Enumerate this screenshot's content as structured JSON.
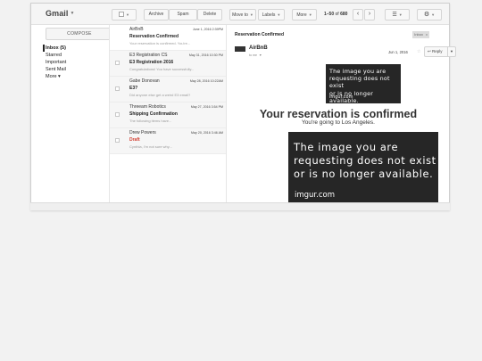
{
  "app": {
    "title": "Gmail"
  },
  "toolbar": {
    "archive_label": "Archive",
    "spam_label": "Spam",
    "delete_label": "Delete",
    "move_to_label": "Move to",
    "labels_label": "Labels",
    "more_label": "More",
    "pager_range": "1–50",
    "pager_of": "of",
    "pager_total": "680",
    "prev_icon": "chevron-left",
    "next_icon": "chevron-right",
    "view_icon": "list-icon",
    "settings_icon": "gear-icon"
  },
  "sidebar": {
    "compose_label": "COMPOSE",
    "items": [
      {
        "label": "Inbox (5)",
        "active": true
      },
      {
        "label": "Starred"
      },
      {
        "label": "Important"
      },
      {
        "label": "Sent Mail"
      },
      {
        "label": "More ▾"
      }
    ]
  },
  "messages": [
    {
      "sender": "AirBnB",
      "date": "June 1, 2016 2:39PM",
      "subject": "Reservation Confirmed",
      "snippet": "Your reservation is confirmed. You're..."
    },
    {
      "sender": "E3 Registration CS",
      "date": "May 31, 2016 10:30 PM",
      "subject": "E3 Registration 2016",
      "snippet": "Congratulations! You have successfully..."
    },
    {
      "sender": "Gabe Donovan",
      "date": "May 28, 2016 10:22AM",
      "subject": "E3?",
      "snippet": "Did anyone else get a weird E3 email?"
    },
    {
      "sender": "Threeam Robotics",
      "date": "May 27, 2016 3:54 PM",
      "subject": "Shipping Confirmation",
      "snippet": "The following items have..."
    },
    {
      "sender": "Drew Powers",
      "date": "May 20, 2016 3:46 AM",
      "subject": "Draft",
      "snippet": "Cynthia, I'm not sure why...",
      "is_draft": true
    }
  ],
  "reading_pane": {
    "subject": "Reservation Confirmed",
    "label_badge": "Inbox",
    "label_close": "x",
    "from": "AirBnB",
    "to": "to me",
    "date": "Jun 1, 2016",
    "reply_label": "Reply",
    "missing_image_text": "The image you are\nrequesting does not exist\nor is no longer available.",
    "missing_image_site": "imgur.com",
    "confirmation_title": "Your reservation is confirmed",
    "confirmation_subtitle": "You're going to Los Angeles."
  }
}
